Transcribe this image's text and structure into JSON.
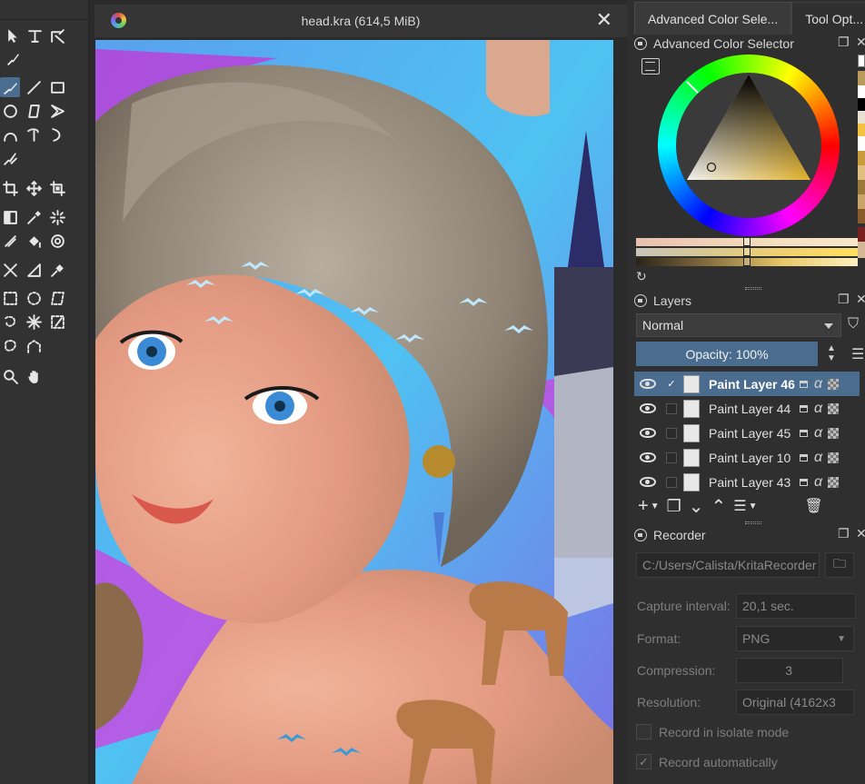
{
  "document": {
    "title": "head.kra (614,5 MiB)",
    "close": "✕"
  },
  "tabs": [
    "Advanced Color Sele...",
    "Tool Opt..."
  ],
  "color_selector": {
    "header": "Advanced Color Selector",
    "current_color": "#e2b22c"
  },
  "layers": {
    "header": "Layers",
    "blend_mode": "Normal",
    "opacity_label": "Opacity:  100%",
    "items": [
      {
        "name": "Paint Layer 46",
        "selected": true,
        "checked": true
      },
      {
        "name": "Paint Layer 44",
        "selected": false,
        "checked": false
      },
      {
        "name": "Paint Layer 45",
        "selected": false,
        "checked": false
      },
      {
        "name": "Paint Layer 10",
        "selected": false,
        "checked": false
      },
      {
        "name": "Paint Layer 43",
        "selected": false,
        "checked": false
      }
    ]
  },
  "recorder": {
    "header": "Recorder",
    "path": "C:/Users/Calista/KritaRecorder",
    "capture_interval_label": "Capture interval:",
    "capture_interval": "20,1 sec.",
    "format_label": "Format:",
    "format": "PNG",
    "compression_label": "Compression:",
    "compression": "3",
    "resolution_label": "Resolution:",
    "resolution": "Original (4162x3",
    "isolate_label": "Record in isolate mode",
    "auto_label": "Record automatically"
  },
  "tools": [
    "select-shapes",
    "text",
    "edit-shapes",
    "calligraphy",
    "freehand-brush",
    "line",
    "rectangle",
    "ellipse",
    "polygon",
    "polyline",
    "bezier-curve",
    "freehand-path",
    "dynamic-brush",
    "multibrush",
    "crop",
    "move",
    "transform",
    "gradient",
    "color-picker",
    "smart-patch",
    "fill",
    "enclosed-fill",
    "assistant",
    "measure",
    "reference",
    "rect-select",
    "ellipse-select",
    "polygon-select",
    "freehand-select",
    "contiguous-select",
    "similar-select",
    "bezier-select",
    "magnetic-select",
    "zoom",
    "pan"
  ],
  "palette_colors": [
    "#f4c242",
    "#ffffff",
    "#000000",
    "#c89c3a",
    "#e0c080",
    "#9c7a3c",
    "#caa36a",
    "#8b5a2b",
    "#d4b896",
    "#6e5030",
    "#b09070",
    "#5a4028"
  ]
}
